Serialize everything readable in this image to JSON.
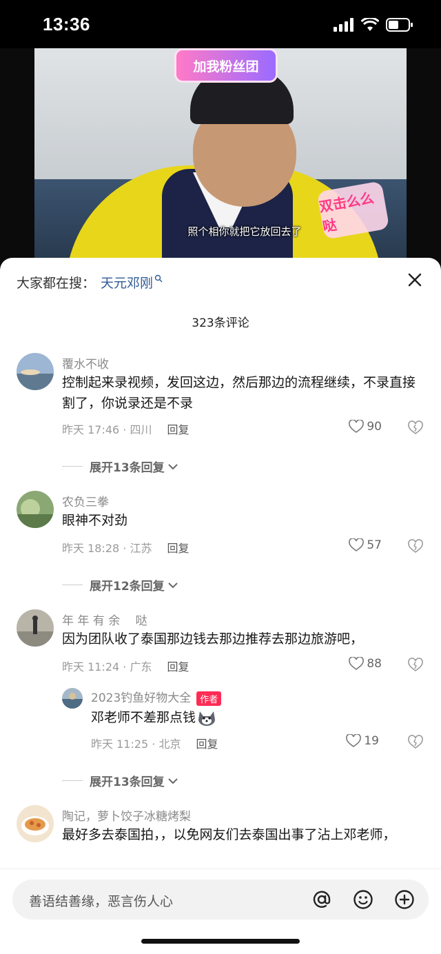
{
  "status_bar": {
    "time": "13:36"
  },
  "video": {
    "fan_sticker": "加我粉丝团",
    "like_sticker": "双击么么哒",
    "subtitle": "照个相你就把它放回去了"
  },
  "search": {
    "prefix": "大家都在搜：",
    "term": "天元邓刚"
  },
  "comment_count": "323条评论",
  "comments": [
    {
      "username": "覆水不收",
      "text": "控制起来录视频，发回这边，然后那边的流程继续，不录直接割了，你说录还是不录",
      "time": "昨天 17:46 · 四川",
      "reply": "回复",
      "likes": "90",
      "expand": "展开13条回复"
    },
    {
      "username": "农负三拳",
      "text": "眼神不对劲",
      "time": "昨天 18:28 · 江苏",
      "reply": "回复",
      "likes": "57",
      "expand": "展开12条回复"
    },
    {
      "username": "年 年 有 余　 哒",
      "text": "因为团队收了泰国那边钱去那边推荐去那边旅游吧，",
      "time": "昨天 11:24 · 广东",
      "reply": "回复",
      "likes": "88",
      "expand": "展开13条回复",
      "sub_reply": {
        "username": "2023钓鱼好物大全",
        "badge": "作者",
        "text": "邓老师不差那点钱",
        "time": "昨天 11:25 · 北京",
        "reply": "回复",
        "likes": "19"
      }
    },
    {
      "username": "陶记，萝卜饺子冰糖烤梨",
      "text": "最好多去泰国拍，，以免网友们去泰国出事了沾上邓老师，"
    }
  ],
  "input": {
    "placeholder": "善语结善缘，恶言伤人心"
  },
  "icons": {
    "close": "close-icon",
    "mention": "at-icon",
    "emoji": "emoji-icon",
    "add": "plus-icon",
    "like": "heart-icon",
    "dislike": "broken-heart-icon"
  },
  "colors": {
    "accent_link": "#2f5a96",
    "author_badge": "#fe2c55"
  }
}
